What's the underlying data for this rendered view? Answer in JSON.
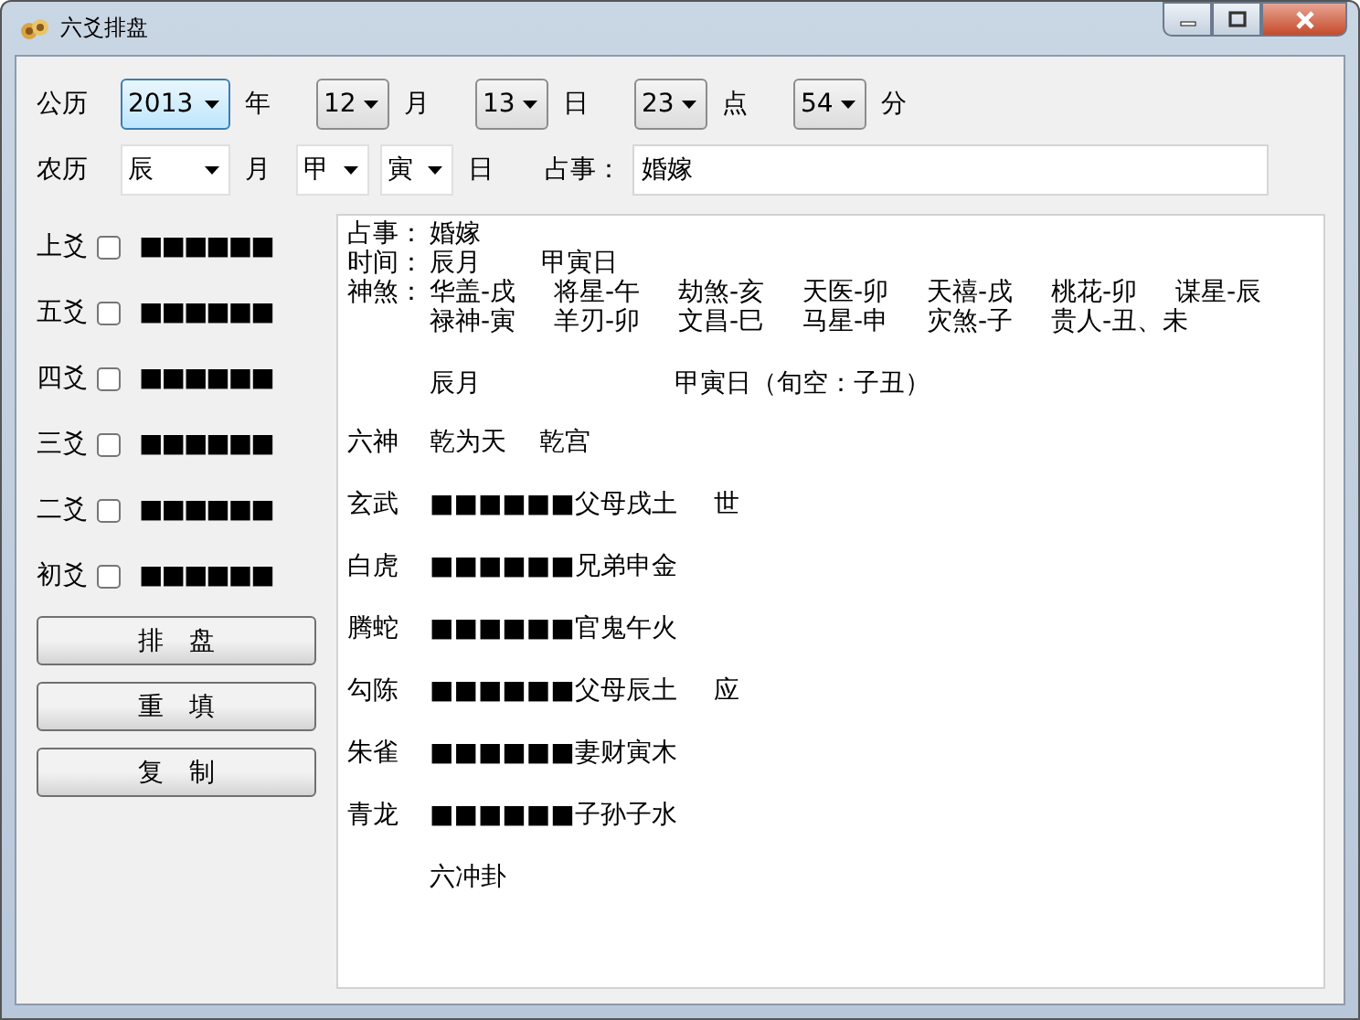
{
  "window": {
    "title": "六爻排盘"
  },
  "solar": {
    "label": "公历",
    "fields": [
      {
        "value": "2013",
        "unit": "年",
        "focused": true
      },
      {
        "value": "12",
        "unit": "月",
        "focused": false
      },
      {
        "value": "13",
        "unit": "日",
        "focused": false
      },
      {
        "value": "23",
        "unit": "点",
        "focused": false
      },
      {
        "value": "54",
        "unit": "分",
        "focused": false
      }
    ]
  },
  "lunar": {
    "label": "农历",
    "month": "辰",
    "month_unit": "月",
    "day_stem": "甲",
    "day_branch": "寅",
    "day_unit": "日",
    "matter_label": "占事：",
    "matter_value": "婚嫁"
  },
  "lines": [
    {
      "label": "上爻",
      "checked": false,
      "symbol": "■■■■■■"
    },
    {
      "label": "五爻",
      "checked": false,
      "symbol": "■■■■■■"
    },
    {
      "label": "四爻",
      "checked": false,
      "symbol": "■■■■■■"
    },
    {
      "label": "三爻",
      "checked": false,
      "symbol": "■■■■■■"
    },
    {
      "label": "二爻",
      "checked": false,
      "symbol": "■■■■■■"
    },
    {
      "label": "初爻",
      "checked": false,
      "symbol": "■■■■■■"
    }
  ],
  "buttons": [
    "排　盘",
    "重　填",
    "复　制"
  ],
  "output": {
    "matter_key": "占事：",
    "matter": "婚嫁",
    "time_key": "时间：",
    "time_month": "辰月",
    "time_day": "甲寅日",
    "shensha_key": "神煞：",
    "shensha": [
      [
        "华盖-戌",
        "将星-午",
        "劫煞-亥",
        "天医-卯",
        "天禧-戌",
        "桃花-卯",
        "谋星-辰"
      ],
      [
        "禄神-寅",
        "羊刃-卯",
        "文昌-巳",
        "马星-申",
        "灾煞-子",
        "贵人-丑、未"
      ]
    ],
    "month": "辰月",
    "day": "甲寅日（旬空：子丑）",
    "hexagram": {
      "label": "六神",
      "name": "乾为天",
      "palace": "乾宫"
    },
    "rows": [
      {
        "spirit": "玄武",
        "symbol": "■■■■■■",
        "relation": "父母戌土",
        "mark": "世"
      },
      {
        "spirit": "白虎",
        "symbol": "■■■■■■",
        "relation": "兄弟申金"
      },
      {
        "spirit": "腾蛇",
        "symbol": "■■■■■■",
        "relation": "官鬼午火"
      },
      {
        "spirit": "勾陈",
        "symbol": "■■■■■■",
        "relation": "父母辰土",
        "mark": "应"
      },
      {
        "spirit": "朱雀",
        "symbol": "■■■■■■",
        "relation": "妻财寅木"
      },
      {
        "spirit": "青龙",
        "symbol": "■■■■■■",
        "relation": "子孙子水"
      }
    ],
    "footer": "六冲卦"
  }
}
